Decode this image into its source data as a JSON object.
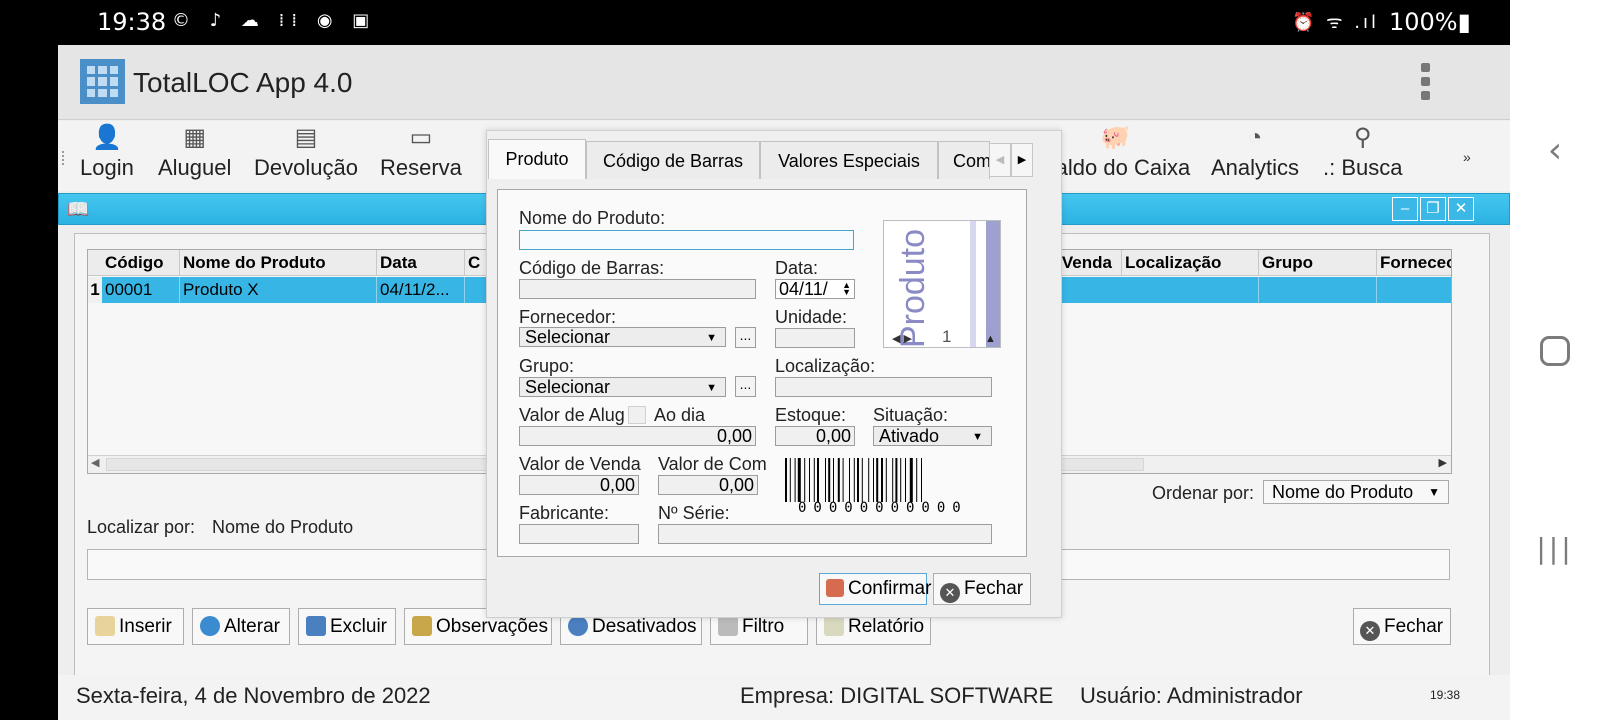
{
  "status_bar": {
    "time": "19:38",
    "left_icons": "© ♪ ☁ ⁞⁞ ◉ ▣",
    "right_icons": "⏰ ᯤ .ıl",
    "battery": "100%▮"
  },
  "app": {
    "title": "TotalLOC App 4.0"
  },
  "toolbar": {
    "items": [
      {
        "label": "Login",
        "icon": "user-icon",
        "glyph": "👤"
      },
      {
        "label": "Aluguel",
        "icon": "rent-icon",
        "glyph": "▦"
      },
      {
        "label": "Devolução",
        "icon": "return-icon",
        "glyph": "▤"
      },
      {
        "label": "Reserva",
        "icon": "calendar-icon",
        "glyph": "▭"
      },
      {
        "label": "Saldo do Caixa",
        "icon": "piggy-bank-icon",
        "glyph": "🐖"
      },
      {
        "label": "Analytics",
        "icon": "pie-chart-icon",
        "glyph": "◔"
      },
      {
        "label": ".: Busca",
        "icon": "search-icon",
        "glyph": "⚲"
      }
    ],
    "more": "»"
  },
  "grid": {
    "columns": [
      "Código",
      "Nome do Produto",
      "Data",
      "C",
      "le Venda",
      "Localização",
      "Grupo",
      "Forneceo"
    ],
    "row": {
      "num": "1",
      "codigo": "00001",
      "nome": "Produto X",
      "data": "04/11/2..."
    }
  },
  "order": {
    "label": "Ordenar por:",
    "value": "Nome do Produto"
  },
  "locate": {
    "label": "Localizar por:",
    "value": "Nome do Produto"
  },
  "buttons": {
    "inserir": "Inserir",
    "alterar": "Alterar",
    "excluir": "Excluir",
    "observacoes": "Observações",
    "desativados": "Desativados",
    "filtro": "Filtro",
    "relatorio": "Relatório",
    "fechar": "Fechar"
  },
  "footer": {
    "date": "Sexta-feira, 4 de Novembro de 2022",
    "company": "Empresa: DIGITAL SOFTWARE",
    "user": "Usuário: Administrador",
    "clock": "19:38"
  },
  "dialog": {
    "tabs": [
      "Produto",
      "Código de Barras",
      "Valores Especiais",
      "Com"
    ],
    "labels": {
      "nome": "Nome do Produto:",
      "codigo_barras": "Código de Barras:",
      "data": "Data:",
      "fornecedor": "Fornecedor:",
      "unidade": "Unidade:",
      "grupo": "Grupo:",
      "localizacao": "Localização:",
      "valor_aluguel": "Valor de Alug",
      "ao_dia": "Ao dia",
      "estoque": "Estoque:",
      "situacao": "Situação:",
      "valor_venda": "Valor de Venda",
      "valor_compra": "Valor de Com",
      "fabricante": "Fabricante:",
      "serie": "Nº Série:"
    },
    "values": {
      "data": "04/11/",
      "fornecedor": "Selecionar",
      "grupo": "Selecionar",
      "valor_aluguel": "0,00",
      "estoque": "0,00",
      "situacao": "Ativado",
      "valor_venda": "0,00",
      "valor_compra": "0,00"
    },
    "image_text": "Produto",
    "image_page": "1",
    "barcode_digits": "00000000000",
    "confirm": "Confirmar",
    "close": "Fechar"
  }
}
